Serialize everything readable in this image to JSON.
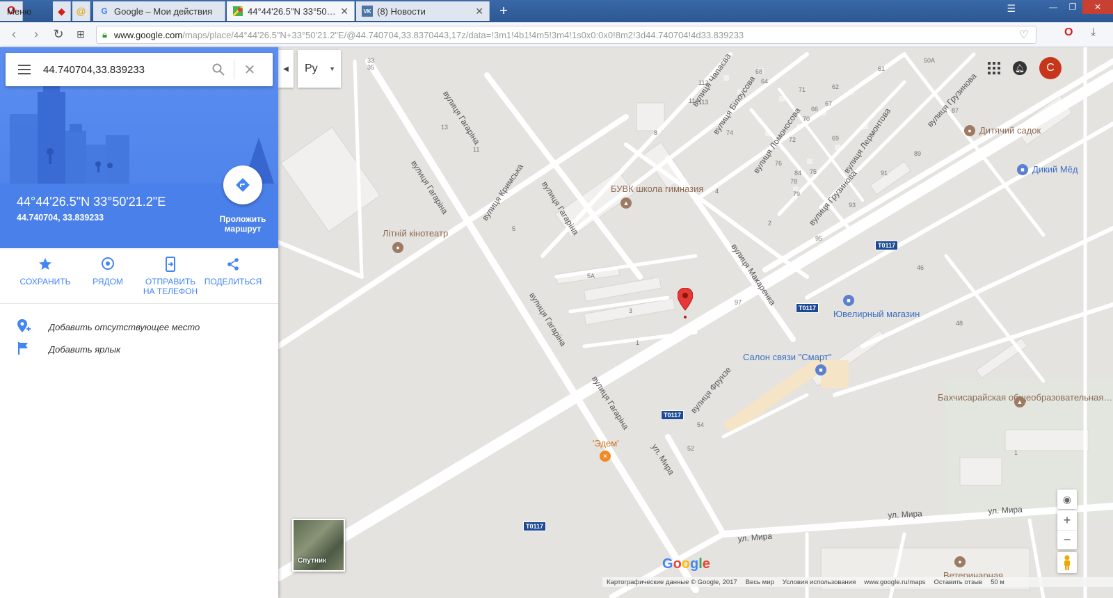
{
  "browser": {
    "menu_label": "Меню",
    "tabs": [
      {
        "title": "Google – Мои действия",
        "icon": "google-g-icon"
      },
      {
        "title": "44°44'26.5\"N 33°50'21.2\"E",
        "icon": "google-maps-icon"
      },
      {
        "title": "(8) Новости",
        "icon": "vk-icon"
      }
    ],
    "url_host": "www.google.com",
    "url_path": "/maps/place/44°44'26.5\"N+33°50'21.2\"E/@44.740704,33.8370443,17z/data=!3m1!4b1!4m5!3m4!1s0x0:0x0!8m2!3d44.740704!4d33.839233"
  },
  "panel": {
    "search_value": "44.740704,33.839233",
    "coords_dms": "44°44'26.5\"N 33°50'21.2\"E",
    "coords_decimal": "44.740704, 33.839233",
    "route_label": "Проложить маршрут",
    "actions": [
      {
        "label": "СОХРАНИТЬ",
        "icon": "star-icon"
      },
      {
        "label": "РЯДОМ",
        "icon": "nearby-icon"
      },
      {
        "label": "ОТПРАВИТЬ НА ТЕЛЕФОН",
        "icon": "send-to-phone-icon"
      },
      {
        "label": "ПОДЕЛИТЬСЯ",
        "icon": "share-icon"
      }
    ],
    "add_missing_place": "Добавить отсутствующее место",
    "add_label": "Добавить ярлык"
  },
  "map": {
    "language": "Ру",
    "account_initial": "С",
    "satellite_label": "Спутник",
    "streets": [
      "вулиця Гагаріна",
      "вулиця Кримська",
      "вулиця Макаренка",
      "вулиця Фрунзе",
      "ул. Мира",
      "вулиця Чапаєва",
      "вулиця Білоусова",
      "вулиця Ломоносова",
      "вулиця Лермонтова",
      "вулиця Грузинова"
    ],
    "pois": [
      {
        "name": "Літній кінотеатр",
        "type": "landmark"
      },
      {
        "name": "БУВК школа гимназия",
        "type": "school"
      },
      {
        "name": "Дитячий садок",
        "type": "landmark"
      },
      {
        "name": "Дикий Мёд",
        "type": "shop"
      },
      {
        "name": "Ювелирный магазин",
        "type": "shop"
      },
      {
        "name": "Салон связи \"Смарт\"",
        "type": "shop"
      },
      {
        "name": "Бахчисарайская общеобразовательная…",
        "type": "school"
      },
      {
        "name": "'Эдем'",
        "type": "restaurant"
      },
      {
        "name": "Ветеринарная",
        "type": "landmark"
      }
    ],
    "road_shield": "T0117",
    "numbers": [
      "33",
      "35",
      "13",
      "11",
      "8",
      "4",
      "5",
      "5А",
      "3",
      "1",
      "2",
      "97",
      "95",
      "93",
      "91",
      "89",
      "87",
      "61",
      "62",
      "69",
      "70",
      "71",
      "74",
      "72",
      "76",
      "78",
      "79",
      "84",
      "112",
      "113",
      "114",
      "64",
      "66",
      "67",
      "68",
      "75",
      "50А",
      "46",
      "48",
      "54",
      "52",
      "1"
    ],
    "footer": [
      "Картографические данные © Google, 2017",
      "Весь мир",
      "Условия использования",
      "www.google.ru/maps",
      "Оставить отзыв",
      "50 м"
    ]
  },
  "colors": {
    "accent_blue": "#4285f4",
    "hero_blue": "#4a80ea",
    "map_bg": "#e5e3df",
    "pin_red": "#e53935",
    "shield_blue": "#1d4a94"
  }
}
